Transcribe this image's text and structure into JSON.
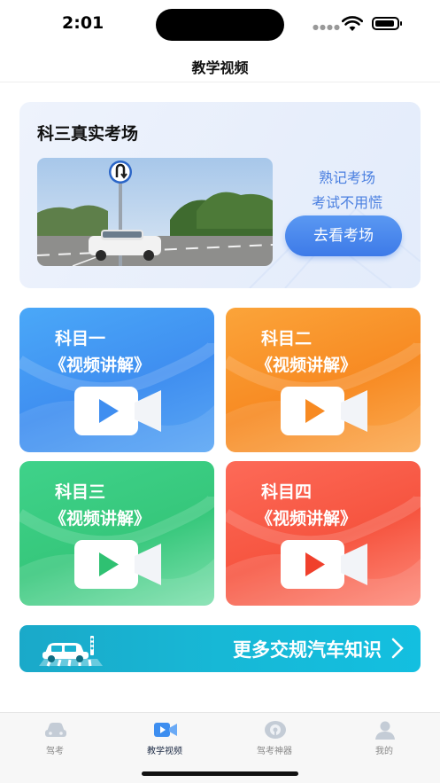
{
  "status_bar": {
    "time": "2:01"
  },
  "nav": {
    "title": "教学视频"
  },
  "exam_hall": {
    "title": "科三真实考场",
    "slogan_line1": "熟记考场",
    "slogan_line2": "考试不用慌",
    "button_label": "去看考场"
  },
  "subjects": [
    {
      "line1": "科目一",
      "line2": "《视频讲解》",
      "color": "#4aa0f6",
      "play_color": "#3f8ef0"
    },
    {
      "line1": "科目二",
      "line2": "《视频讲解》",
      "color": "#f99330",
      "play_color": "#f78a22"
    },
    {
      "line1": "科目三",
      "line2": "《视频讲解》",
      "color": "#3acd83",
      "play_color": "#2fc172"
    },
    {
      "line1": "科目四",
      "line2": "《视频讲解》",
      "color": "#fa5f4b",
      "play_color": "#f0402c"
    }
  ],
  "banner": {
    "text": "更多交规汽车知识"
  },
  "tabbar": {
    "items": [
      {
        "label": "驾考",
        "icon": "car-icon"
      },
      {
        "label": "教学视频",
        "icon": "video-camera-icon"
      },
      {
        "label": "驾考神器",
        "icon": "steering-wheel-icon"
      },
      {
        "label": "我的",
        "icon": "person-icon"
      }
    ],
    "active_index": 1
  }
}
